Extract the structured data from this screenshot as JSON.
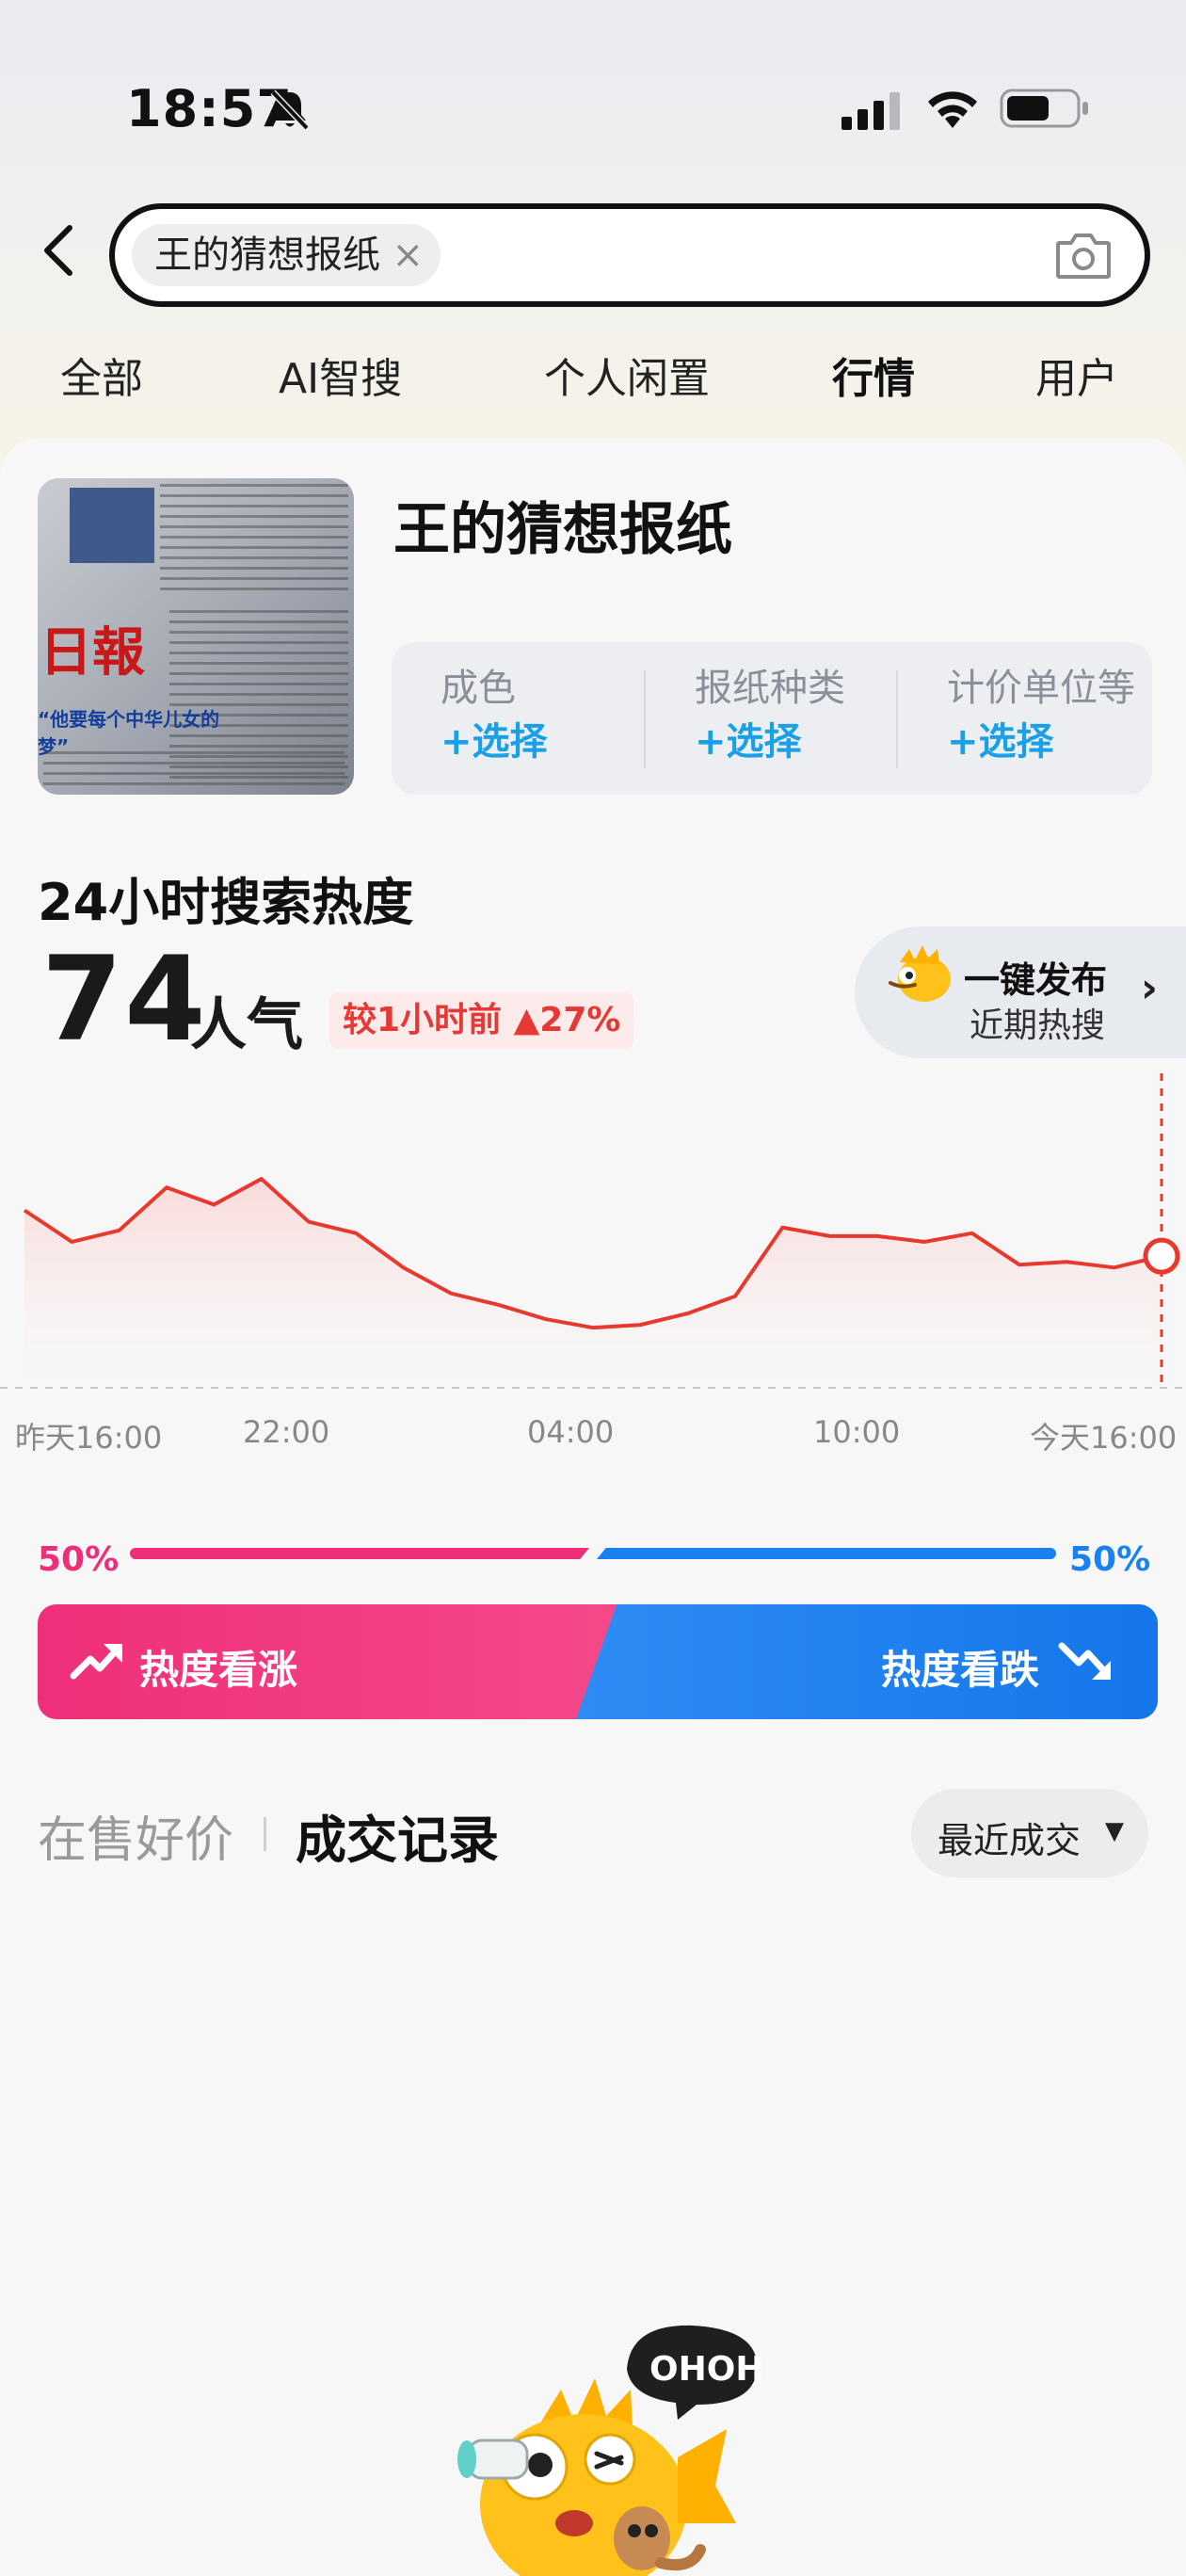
{
  "status_bar": {
    "time": "18:57"
  },
  "search": {
    "query": "王的猜想报纸",
    "clear_glyph": "×"
  },
  "tabs": [
    {
      "label": "全部"
    },
    {
      "label": "AI智搜"
    },
    {
      "label": "个人闲置"
    },
    {
      "label": "行情",
      "active": true
    },
    {
      "label": "用户"
    }
  ],
  "product": {
    "title": "王的猜想报纸",
    "specs": [
      {
        "label": "成色",
        "action": "+选择"
      },
      {
        "label": "报纸种类",
        "action": "+选择"
      },
      {
        "label": "计价单位等",
        "action": "+选择"
      }
    ]
  },
  "heat": {
    "title": "24小时搜索热度",
    "value": "74",
    "unit": "人气",
    "compare": "较1小时前 ▲27%",
    "publish": {
      "line1": "一键发布",
      "line2": "近期热搜",
      "arrow": "›"
    }
  },
  "chart_data": {
    "type": "area",
    "x_labels": [
      "昨天16:00",
      "22:00",
      "04:00",
      "10:00",
      "今天16:00"
    ],
    "values": [
      62,
      51,
      55,
      70,
      64,
      73,
      58,
      54,
      42,
      33,
      29,
      24,
      21,
      22,
      26,
      32,
      56,
      53,
      53,
      51,
      54,
      43,
      44,
      42,
      46
    ],
    "ylim": [
      0,
      100
    ],
    "colors": {
      "line": "#e8392f",
      "fill_top": "#fbd6d6",
      "fill_bottom": "#f7f7f7"
    }
  },
  "vote": {
    "up_percent": "50%",
    "down_percent": "50%",
    "up_label": "热度看涨",
    "down_label": "热度看跌",
    "colors": {
      "up": "#ee2e78",
      "down": "#1a82f0"
    }
  },
  "records": {
    "tab_inactive": "在售好价",
    "tab_active": "成交记录",
    "sort_label": "最近成交",
    "sort_caret": "▼"
  },
  "mascot": {
    "bubble_text": "OHOH"
  }
}
